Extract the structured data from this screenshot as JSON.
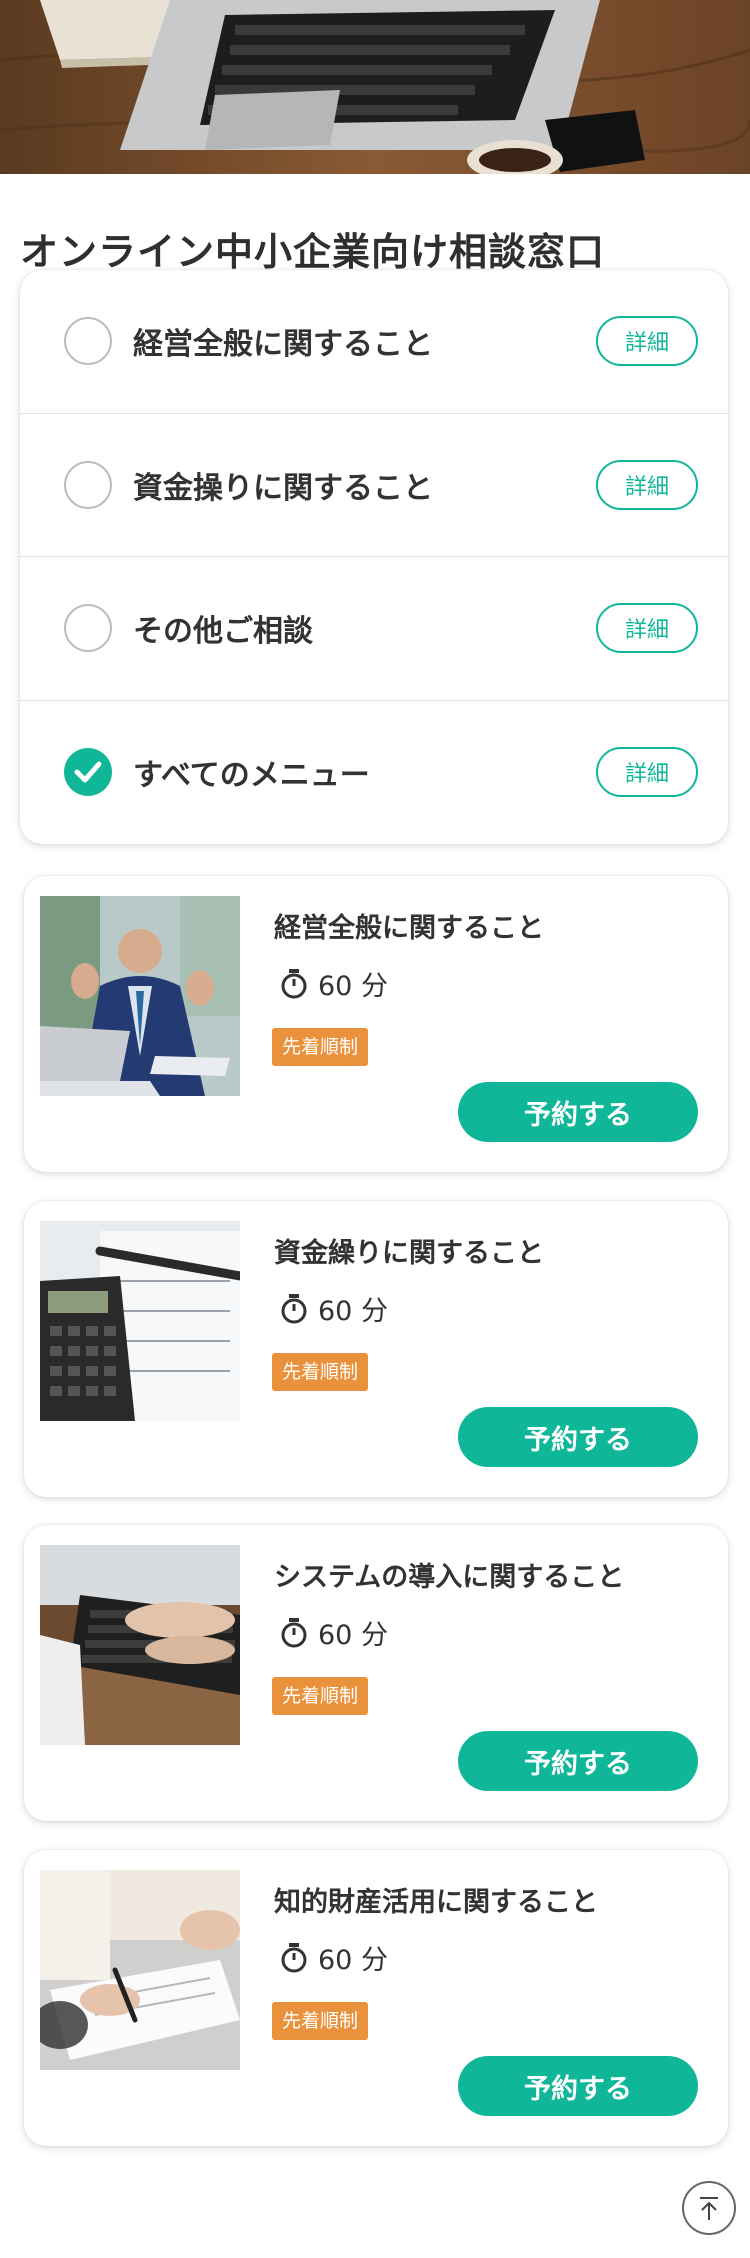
{
  "page": {
    "title": "オンライン中小企業向け相談窓口"
  },
  "menu": {
    "items": [
      {
        "label": "経営全般に関すること",
        "detail_label": "詳細",
        "checked": false
      },
      {
        "label": "資金操りに関すること",
        "detail_label": "詳細",
        "checked": false
      },
      {
        "label": "その他ご相談",
        "detail_label": "詳細",
        "checked": false
      },
      {
        "label": "すべてのメニュー",
        "detail_label": "詳細",
        "checked": true
      }
    ]
  },
  "courses": [
    {
      "title": "経営全般に関すること",
      "duration": "60 分",
      "badge": "先着順制",
      "button": "予約する",
      "image": "businessman-laptop-photo"
    },
    {
      "title": "資金繰りに関すること",
      "duration": "60 分",
      "badge": "先着順制",
      "button": "予約する",
      "image": "calculator-pen-photo"
    },
    {
      "title": "システムの導入に関すること",
      "duration": "60 分",
      "badge": "先着順制",
      "button": "予約する",
      "image": "keyboard-typing-photo"
    },
    {
      "title": "知的財産活用に関すること",
      "duration": "60 分",
      "badge": "先着順制",
      "button": "予約する",
      "image": "signing-document-photo"
    }
  ],
  "colors": {
    "accent": "#10b698",
    "badge": "#e9913b"
  },
  "icons": {
    "duration": "stopwatch-icon",
    "scroll_top": "arrow-up-to-top-icon",
    "checked": "check-icon"
  }
}
